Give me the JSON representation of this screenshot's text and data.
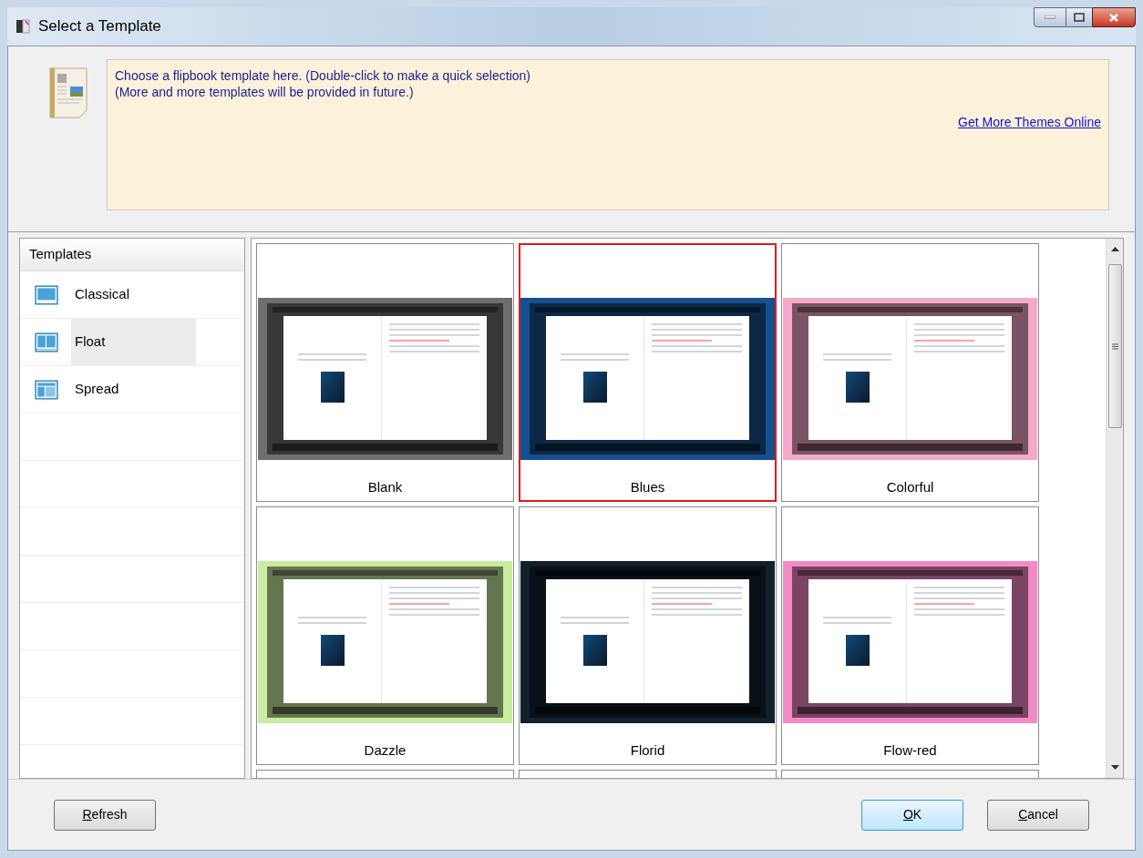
{
  "window": {
    "title": "Select a Template"
  },
  "info": {
    "lines": [
      "Choose a flipbook template here. (Double-click to make a quick selection)",
      "(More and more templates will be provided in future.)"
    ],
    "link": "Get More Themes Online"
  },
  "sidebar": {
    "header": "Templates",
    "items": [
      {
        "label": "Classical",
        "kind": "classical",
        "selected": false
      },
      {
        "label": "Float",
        "kind": "float",
        "selected": true
      },
      {
        "label": "Spread",
        "kind": "spread",
        "selected": false
      }
    ]
  },
  "templates": [
    {
      "name": "Blank",
      "color": "#6e6e6e",
      "selected": false
    },
    {
      "name": "Blues",
      "color": "#16508f",
      "selected": true
    },
    {
      "name": "Colorful",
      "color": "#f5a9c9",
      "selected": false
    },
    {
      "name": "Dazzle",
      "color": "#c9eca0",
      "selected": false
    },
    {
      "name": "Florid",
      "color": "#12202c",
      "selected": false
    },
    {
      "name": "Flow-red",
      "color": "#f28ac6",
      "selected": false
    }
  ],
  "buttons": [
    {
      "label": "Refresh",
      "kind": "refresh"
    },
    {
      "label": "OK",
      "kind": "ok"
    },
    {
      "label": "Cancel",
      "kind": "cancel"
    }
  ]
}
